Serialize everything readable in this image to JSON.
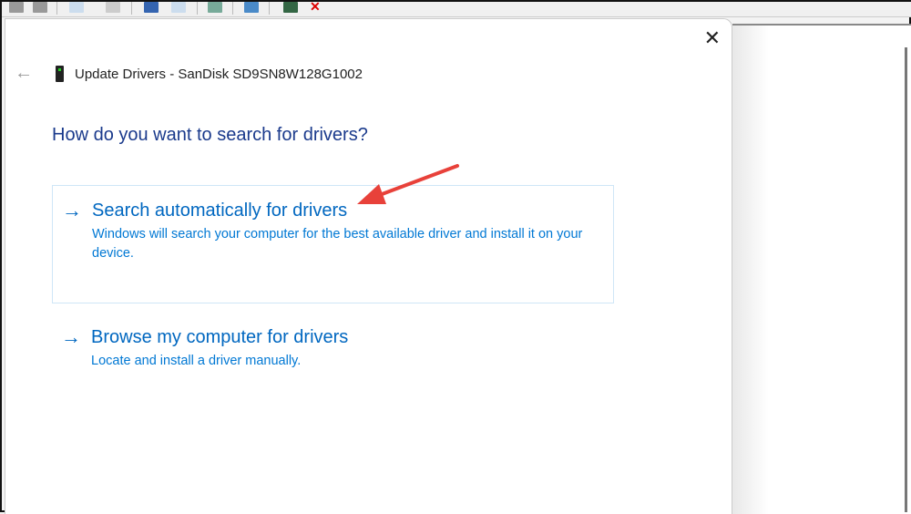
{
  "dialog": {
    "title": "Update Drivers - SanDisk SD9SN8W128G1002",
    "question": "How do you want to search for drivers?"
  },
  "options": [
    {
      "title": "Search automatically for drivers",
      "description": "Windows will search your computer for the best available driver and install it on your device."
    },
    {
      "title": "Browse my computer for drivers",
      "description": "Locate and install a driver manually."
    }
  ],
  "icons": {
    "back": "back-arrow-icon",
    "close": "close-icon",
    "device": "drive-icon",
    "option": "arrow-right-icon"
  },
  "colors": {
    "link": "#0067c0",
    "annotation": "#e8413a"
  }
}
